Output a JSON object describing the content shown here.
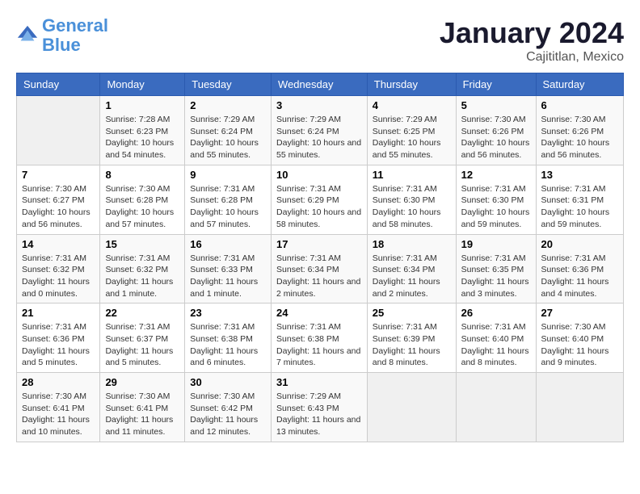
{
  "header": {
    "logo_line1": "General",
    "logo_line2": "Blue",
    "main_title": "January 2024",
    "subtitle": "Cajititlan, Mexico"
  },
  "days_of_week": [
    "Sunday",
    "Monday",
    "Tuesday",
    "Wednesday",
    "Thursday",
    "Friday",
    "Saturday"
  ],
  "weeks": [
    [
      {
        "num": "",
        "sunrise": "",
        "sunset": "",
        "daylight": ""
      },
      {
        "num": "1",
        "sunrise": "Sunrise: 7:28 AM",
        "sunset": "Sunset: 6:23 PM",
        "daylight": "Daylight: 10 hours and 54 minutes."
      },
      {
        "num": "2",
        "sunrise": "Sunrise: 7:29 AM",
        "sunset": "Sunset: 6:24 PM",
        "daylight": "Daylight: 10 hours and 55 minutes."
      },
      {
        "num": "3",
        "sunrise": "Sunrise: 7:29 AM",
        "sunset": "Sunset: 6:24 PM",
        "daylight": "Daylight: 10 hours and 55 minutes."
      },
      {
        "num": "4",
        "sunrise": "Sunrise: 7:29 AM",
        "sunset": "Sunset: 6:25 PM",
        "daylight": "Daylight: 10 hours and 55 minutes."
      },
      {
        "num": "5",
        "sunrise": "Sunrise: 7:30 AM",
        "sunset": "Sunset: 6:26 PM",
        "daylight": "Daylight: 10 hours and 56 minutes."
      },
      {
        "num": "6",
        "sunrise": "Sunrise: 7:30 AM",
        "sunset": "Sunset: 6:26 PM",
        "daylight": "Daylight: 10 hours and 56 minutes."
      }
    ],
    [
      {
        "num": "7",
        "sunrise": "Sunrise: 7:30 AM",
        "sunset": "Sunset: 6:27 PM",
        "daylight": "Daylight: 10 hours and 56 minutes."
      },
      {
        "num": "8",
        "sunrise": "Sunrise: 7:30 AM",
        "sunset": "Sunset: 6:28 PM",
        "daylight": "Daylight: 10 hours and 57 minutes."
      },
      {
        "num": "9",
        "sunrise": "Sunrise: 7:31 AM",
        "sunset": "Sunset: 6:28 PM",
        "daylight": "Daylight: 10 hours and 57 minutes."
      },
      {
        "num": "10",
        "sunrise": "Sunrise: 7:31 AM",
        "sunset": "Sunset: 6:29 PM",
        "daylight": "Daylight: 10 hours and 58 minutes."
      },
      {
        "num": "11",
        "sunrise": "Sunrise: 7:31 AM",
        "sunset": "Sunset: 6:30 PM",
        "daylight": "Daylight: 10 hours and 58 minutes."
      },
      {
        "num": "12",
        "sunrise": "Sunrise: 7:31 AM",
        "sunset": "Sunset: 6:30 PM",
        "daylight": "Daylight: 10 hours and 59 minutes."
      },
      {
        "num": "13",
        "sunrise": "Sunrise: 7:31 AM",
        "sunset": "Sunset: 6:31 PM",
        "daylight": "Daylight: 10 hours and 59 minutes."
      }
    ],
    [
      {
        "num": "14",
        "sunrise": "Sunrise: 7:31 AM",
        "sunset": "Sunset: 6:32 PM",
        "daylight": "Daylight: 11 hours and 0 minutes."
      },
      {
        "num": "15",
        "sunrise": "Sunrise: 7:31 AM",
        "sunset": "Sunset: 6:32 PM",
        "daylight": "Daylight: 11 hours and 1 minute."
      },
      {
        "num": "16",
        "sunrise": "Sunrise: 7:31 AM",
        "sunset": "Sunset: 6:33 PM",
        "daylight": "Daylight: 11 hours and 1 minute."
      },
      {
        "num": "17",
        "sunrise": "Sunrise: 7:31 AM",
        "sunset": "Sunset: 6:34 PM",
        "daylight": "Daylight: 11 hours and 2 minutes."
      },
      {
        "num": "18",
        "sunrise": "Sunrise: 7:31 AM",
        "sunset": "Sunset: 6:34 PM",
        "daylight": "Daylight: 11 hours and 2 minutes."
      },
      {
        "num": "19",
        "sunrise": "Sunrise: 7:31 AM",
        "sunset": "Sunset: 6:35 PM",
        "daylight": "Daylight: 11 hours and 3 minutes."
      },
      {
        "num": "20",
        "sunrise": "Sunrise: 7:31 AM",
        "sunset": "Sunset: 6:36 PM",
        "daylight": "Daylight: 11 hours and 4 minutes."
      }
    ],
    [
      {
        "num": "21",
        "sunrise": "Sunrise: 7:31 AM",
        "sunset": "Sunset: 6:36 PM",
        "daylight": "Daylight: 11 hours and 5 minutes."
      },
      {
        "num": "22",
        "sunrise": "Sunrise: 7:31 AM",
        "sunset": "Sunset: 6:37 PM",
        "daylight": "Daylight: 11 hours and 5 minutes."
      },
      {
        "num": "23",
        "sunrise": "Sunrise: 7:31 AM",
        "sunset": "Sunset: 6:38 PM",
        "daylight": "Daylight: 11 hours and 6 minutes."
      },
      {
        "num": "24",
        "sunrise": "Sunrise: 7:31 AM",
        "sunset": "Sunset: 6:38 PM",
        "daylight": "Daylight: 11 hours and 7 minutes."
      },
      {
        "num": "25",
        "sunrise": "Sunrise: 7:31 AM",
        "sunset": "Sunset: 6:39 PM",
        "daylight": "Daylight: 11 hours and 8 minutes."
      },
      {
        "num": "26",
        "sunrise": "Sunrise: 7:31 AM",
        "sunset": "Sunset: 6:40 PM",
        "daylight": "Daylight: 11 hours and 8 minutes."
      },
      {
        "num": "27",
        "sunrise": "Sunrise: 7:30 AM",
        "sunset": "Sunset: 6:40 PM",
        "daylight": "Daylight: 11 hours and 9 minutes."
      }
    ],
    [
      {
        "num": "28",
        "sunrise": "Sunrise: 7:30 AM",
        "sunset": "Sunset: 6:41 PM",
        "daylight": "Daylight: 11 hours and 10 minutes."
      },
      {
        "num": "29",
        "sunrise": "Sunrise: 7:30 AM",
        "sunset": "Sunset: 6:41 PM",
        "daylight": "Daylight: 11 hours and 11 minutes."
      },
      {
        "num": "30",
        "sunrise": "Sunrise: 7:30 AM",
        "sunset": "Sunset: 6:42 PM",
        "daylight": "Daylight: 11 hours and 12 minutes."
      },
      {
        "num": "31",
        "sunrise": "Sunrise: 7:29 AM",
        "sunset": "Sunset: 6:43 PM",
        "daylight": "Daylight: 11 hours and 13 minutes."
      },
      {
        "num": "",
        "sunrise": "",
        "sunset": "",
        "daylight": ""
      },
      {
        "num": "",
        "sunrise": "",
        "sunset": "",
        "daylight": ""
      },
      {
        "num": "",
        "sunrise": "",
        "sunset": "",
        "daylight": ""
      }
    ]
  ]
}
